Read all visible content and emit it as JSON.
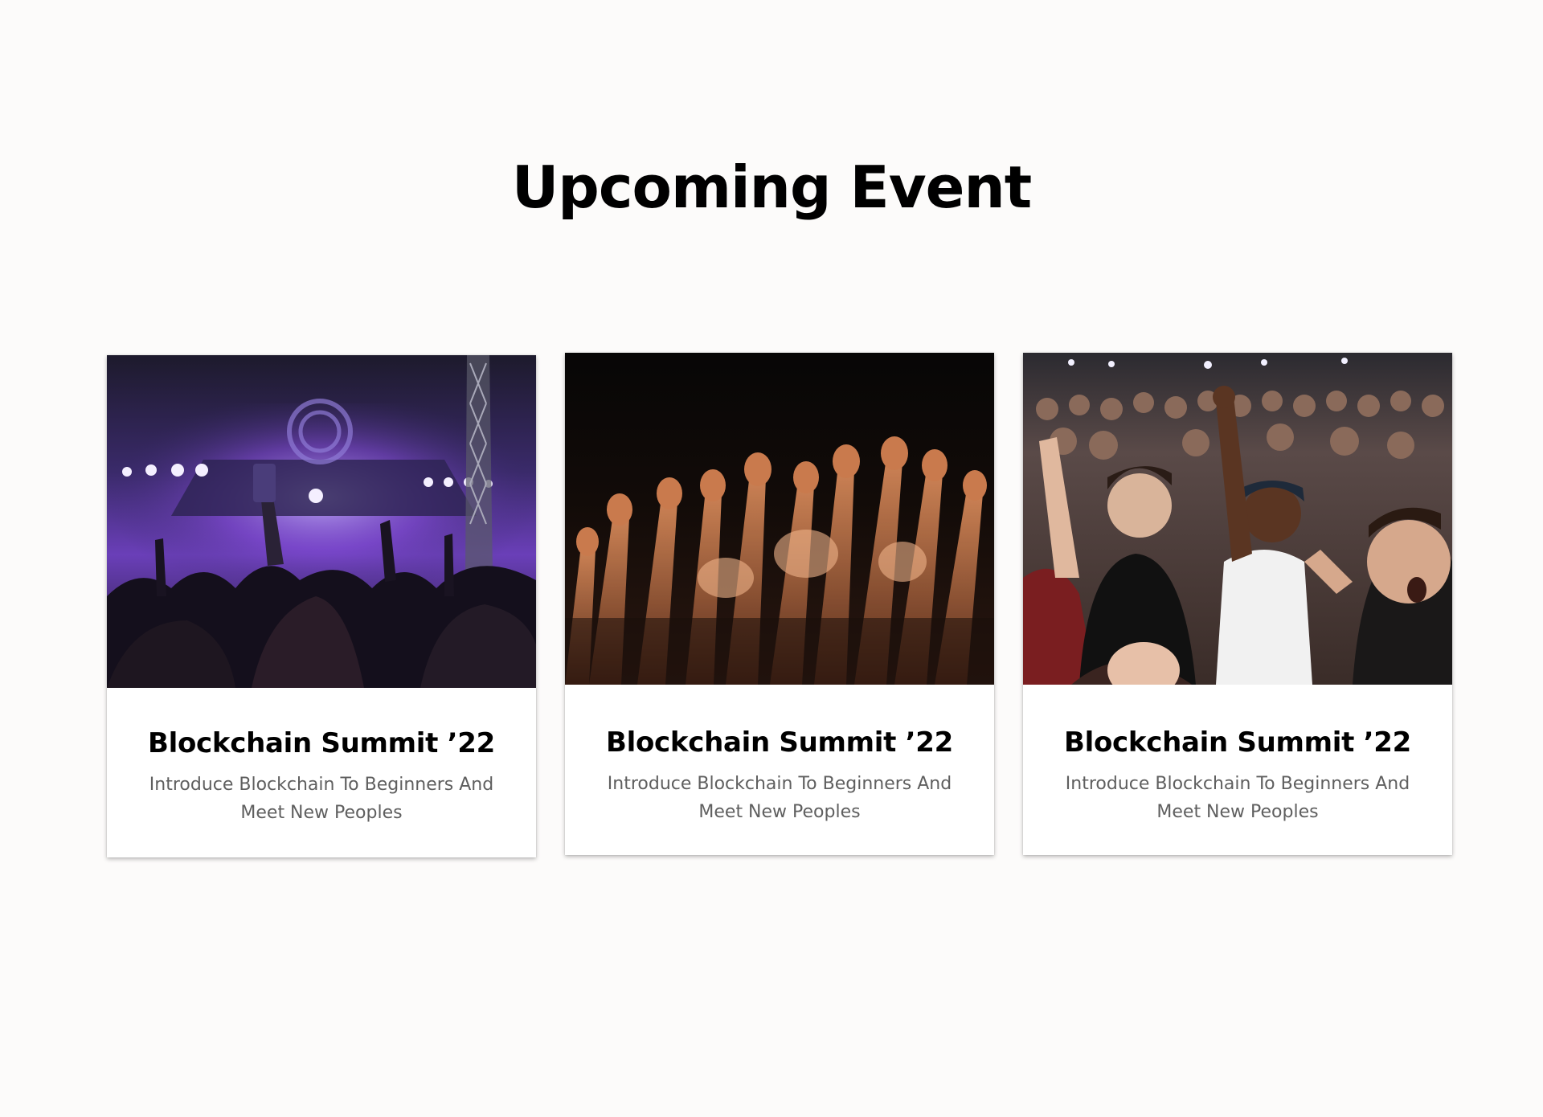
{
  "section": {
    "title": "Upcoming Event"
  },
  "events": [
    {
      "title": "Blockchain Summit ’22",
      "description": "Introduce Blockchain To Beginners And Meet New Peoples",
      "image": "concert-stage-purple-lights-photo"
    },
    {
      "title": "Blockchain Summit ’22",
      "description": "Introduce Blockchain To Beginners And Meet New Peoples",
      "image": "crowd-raised-hands-photo"
    },
    {
      "title": "Blockchain Summit ’22",
      "description": "Introduce Blockchain To Beginners And Meet New Peoples",
      "image": "cheering-crowd-photo"
    }
  ]
}
